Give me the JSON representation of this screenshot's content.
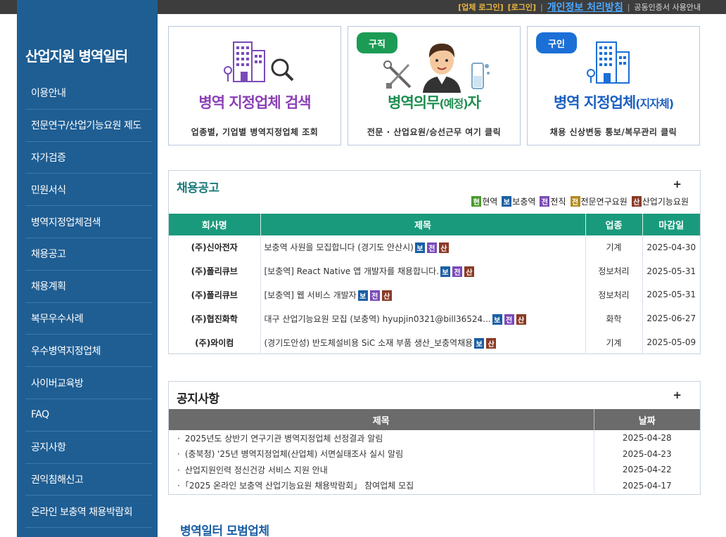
{
  "topbar": {
    "company_login": "[업체 로그인]",
    "login": "[로그인]",
    "privacy": "개인정보 처리방침",
    "cert_guide": "공동인증서 사용안내"
  },
  "sidebar": {
    "brand": "산업지원 병역일터",
    "items": [
      {
        "label": "이용안내"
      },
      {
        "label": "전문연구/산업기능요원 제도"
      },
      {
        "label": "자가검증"
      },
      {
        "label": "민원서식"
      },
      {
        "label": "병역지정업체검색"
      },
      {
        "label": "채용공고"
      },
      {
        "label": "채용계획"
      },
      {
        "label": "복무우수사례"
      },
      {
        "label": "우수병역지정업체"
      },
      {
        "label": "사이버교육방"
      },
      {
        "label": "FAQ"
      },
      {
        "label": "공지사항"
      },
      {
        "label": "권익침해신고"
      },
      {
        "label": "온라인 보충역 채용박람회"
      }
    ]
  },
  "cards": {
    "search": {
      "title": "병역 지정업체 검색",
      "sub": "업종별, 기업별 병역지정업체 조회"
    },
    "job_seek": {
      "pill": "구직",
      "title_main": "병역의무",
      "title_small": "(예정)",
      "title_end": "자",
      "sub": "전문 · 산업요원/승선근무 여기 클릭"
    },
    "hiring": {
      "pill": "구인",
      "title_main": "병역 지정업체",
      "title_small": "(지자체)",
      "sub": "채용 신상변동 통보/복무관리 클릭"
    }
  },
  "recruit": {
    "title": "채용공고",
    "more": "+",
    "legend": [
      {
        "tag": "현",
        "label": "현역",
        "cls": "t-hyun"
      },
      {
        "tag": "보",
        "label": "보충역",
        "cls": "t-bo"
      },
      {
        "tag": "전",
        "label": "전직",
        "cls": "t-jeon"
      },
      {
        "tag": "전",
        "label": "전문연구요원",
        "cls": "t-jeon2"
      },
      {
        "tag": "산",
        "label": "산업기능요원",
        "cls": "t-san"
      }
    ],
    "columns": [
      "회사명",
      "제목",
      "업종",
      "마감일"
    ],
    "rows": [
      {
        "company": "(주)신아전자",
        "title": "보충역 사원을 모집합니다 (경기도 안산시)",
        "tags": [
          "보",
          "전",
          "산"
        ],
        "industry": "기계",
        "deadline": "2025-04-30"
      },
      {
        "company": "(주)폴리큐브",
        "title": "[보충역] React Native 앱 개발자를 채용합니다.",
        "tags": [
          "보",
          "전",
          "산"
        ],
        "industry": "정보처리",
        "deadline": "2025-05-31"
      },
      {
        "company": "(주)폴리큐브",
        "title": "[보충역] 웹 서비스 개발자",
        "tags": [
          "보",
          "전",
          "산"
        ],
        "industry": "정보처리",
        "deadline": "2025-05-31"
      },
      {
        "company": "(주)협진화학",
        "title": "대구 산업기능요원 모집 (보충역) hyupjin0321@bill36524...",
        "tags": [
          "보",
          "전",
          "산"
        ],
        "industry": "화학",
        "deadline": "2025-06-27"
      },
      {
        "company": "(주)와이컴",
        "title": "(경기도안성) 반도체설비용 SiC 소재 부품 생산_보충역채용",
        "tags": [
          "보",
          "산"
        ],
        "industry": "기계",
        "deadline": "2025-05-09"
      }
    ]
  },
  "notice": {
    "title": "공지사항",
    "more": "+",
    "columns": [
      "제목",
      "날짜"
    ],
    "rows": [
      {
        "title": "2025년도 상반기 연구기관 병역지정업체 선정결과 알림",
        "date": "2025-04-28"
      },
      {
        "title": "(충북청) '25년 병역지정업체(산업체) 서면실태조사 실시 알림",
        "date": "2025-04-23"
      },
      {
        "title": "산업지원인력 정신건강 서비스 지원 안내",
        "date": "2025-04-22"
      },
      {
        "title": "「2025 온라인 보충역 산업기능요원 채용박람회」 참여업체 모집",
        "date": "2025-04-17"
      }
    ]
  },
  "model": {
    "title": "병역일터 모범업체"
  },
  "colors": {
    "sidebar": "#1f5e93",
    "recruit_header": "#1a9a7c",
    "notice_header": "#6b6b6b"
  }
}
